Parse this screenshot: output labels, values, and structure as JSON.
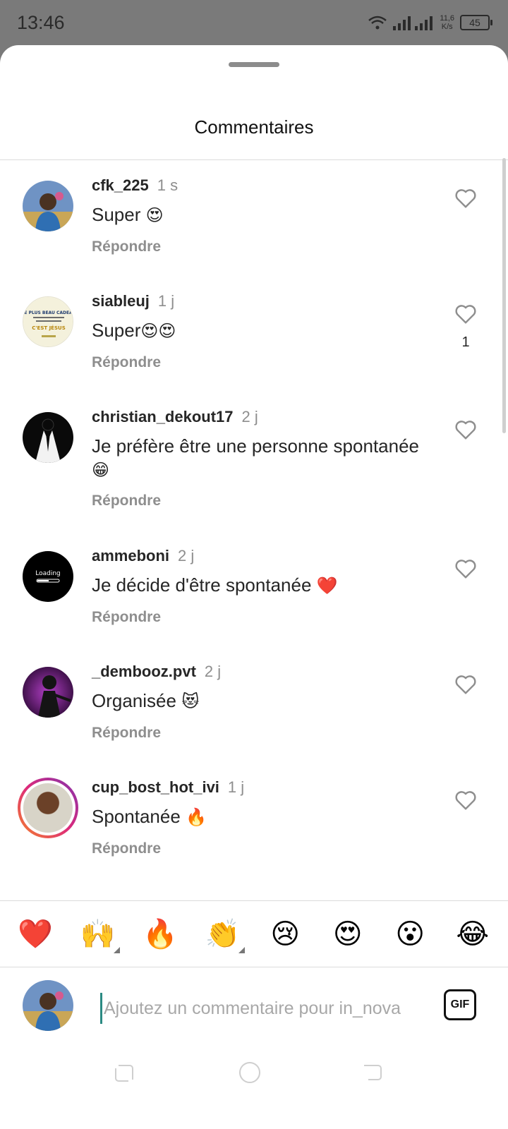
{
  "status_bar": {
    "time": "13:46",
    "speed_value": "11,6",
    "speed_unit": "K/s",
    "battery": "45"
  },
  "sheet": {
    "title": "Commentaires"
  },
  "comments": [
    {
      "username": "cfk_225",
      "time": "1 s",
      "text": "Super",
      "emoji": "😍",
      "reply": "Répondre",
      "likes": ""
    },
    {
      "username": "siableuj",
      "time": "1 j",
      "text": "Super",
      "emoji": "😍😍",
      "reply": "Répondre",
      "likes": "1"
    },
    {
      "username": "christian_dekout17",
      "time": "2 j",
      "text": "Je préfère être une personne spontanée",
      "emoji": "😁",
      "reply": "Répondre",
      "likes": ""
    },
    {
      "username": "ammeboni",
      "time": "2 j",
      "text": "Je décide d'être spontanée",
      "emoji": "❤️",
      "reply": "Répondre",
      "likes": ""
    },
    {
      "username": "_dembooz.pvt",
      "time": "2 j",
      "text": "Organisée",
      "emoji": "😻",
      "reply": "Répondre",
      "likes": ""
    },
    {
      "username": "cup_bost_hot_ivi",
      "time": "1 j",
      "text": "Spontanée",
      "emoji": "🔥",
      "reply": "Répondre",
      "likes": ""
    }
  ],
  "avatar_texts": {
    "siableuj": "LE PLUS BEAU CADEAU C'EST JÉSUS",
    "ammeboni": "Loading"
  },
  "reactions": [
    "❤️",
    "🙌",
    "🔥",
    "👏",
    "😢",
    "😍",
    "😮",
    "😂"
  ],
  "composer": {
    "placeholder": "Ajoutez un commentaire pour in_nova",
    "gif_label": "GIF"
  },
  "colors": {
    "accent_story": "#dd2a7b",
    "cursor": "#2b8a83",
    "meta_grey": "#8e8e8e"
  }
}
